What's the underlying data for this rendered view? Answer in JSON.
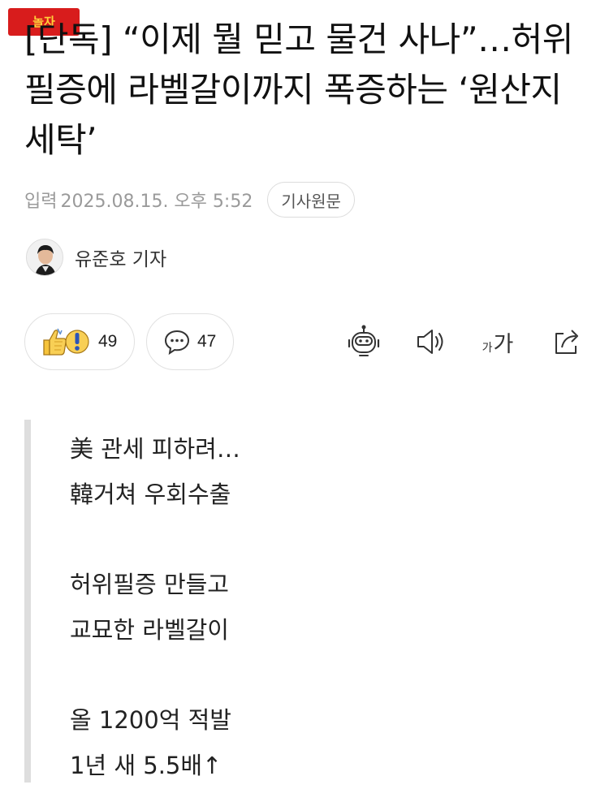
{
  "logo": {
    "text": "놀자"
  },
  "article": {
    "headline": "[단독] “이제 뭘 믿고 물건 사나”…허위필증에 라벨갈이까지 폭증하는 ‘원산지 세탁’",
    "date_label": "입력",
    "date_value": "2025.08.15. 오후 5:52",
    "original_button": "기사원문",
    "author": "유준호 기자"
  },
  "reactions": {
    "likes": "49",
    "comments": "47"
  },
  "tools": {
    "font_small": "가",
    "font_large": "가"
  },
  "icons": [
    "thumbs-up-icon",
    "exclamation-icon",
    "comment-icon",
    "robot-summary-icon",
    "speaker-icon",
    "font-size-icon",
    "share-icon"
  ],
  "quote": {
    "lines": [
      "美 관세 피하려…",
      "韓거쳐 우회수출",
      "",
      "허위필증 만들고",
      "교묘한 라벨갈이",
      "",
      "올 1200억 적발",
      "1년 새 5.5배↑"
    ]
  },
  "colors": {
    "logo_bg": "#d81c1c",
    "logo_text": "#ffd23a",
    "quote_bar": "#dedede",
    "muted_text": "#9a9a9a"
  }
}
